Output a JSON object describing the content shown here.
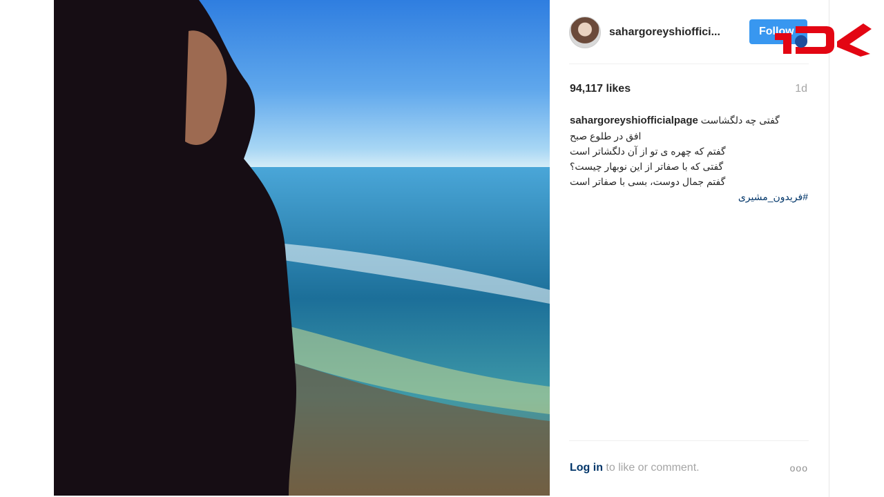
{
  "post": {
    "username": "sahargoreyshiofficialpage",
    "username_short": "sahargoreyshioffici...",
    "follow_label": "Follow",
    "likes": "94,117 likes",
    "time": "1d",
    "caption": {
      "user": "sahargoreyshiofficialpage",
      "lines": [
        "گفتی چه دلگشاست",
        "افق در طلوع صبح",
        "گفتم که چهره ی تو از آن دلگشاتر است",
        "گفتی که با صفاتر از این نوبهار چیست؟",
        "گفتم جمال دوست، بسی با صفاتر است"
      ],
      "hashtag": "#فریدون_مشیری"
    },
    "login_link": "Log in",
    "login_rest": " to like or comment.",
    "more": "ooo"
  },
  "icons": {
    "avatar": "profile-avatar-icon",
    "more": "more-options-icon",
    "logo": "rokna-logo-icon"
  },
  "colors": {
    "follow": "#3897f0",
    "logo_red": "#e30613",
    "link": "#003569"
  }
}
